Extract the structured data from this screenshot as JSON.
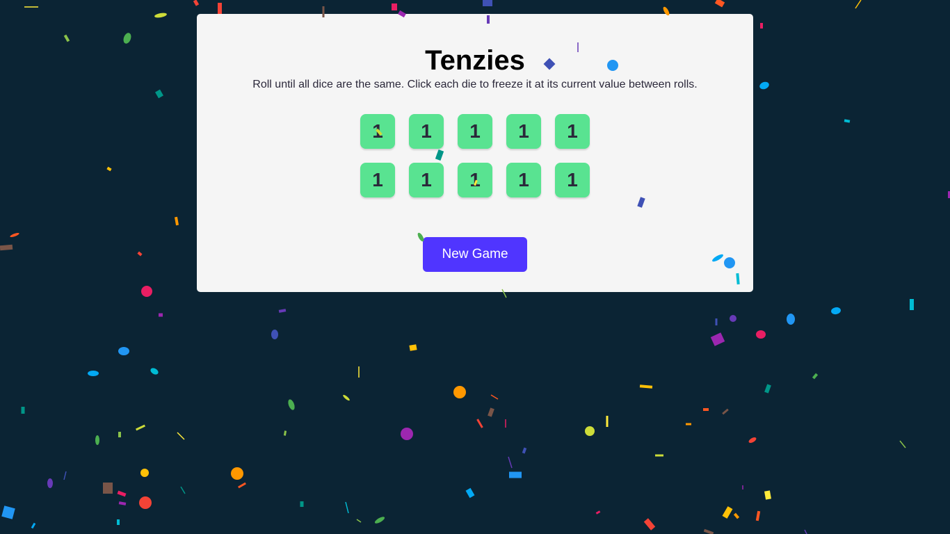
{
  "game": {
    "title": "Tenzies",
    "instructions": "Roll until all dice are the same. Click each die to freeze it at its current value between rolls.",
    "dice": [
      "1",
      "1",
      "1",
      "1",
      "1",
      "1",
      "1",
      "1",
      "1",
      "1"
    ],
    "button_label": "New Game"
  },
  "colors": {
    "background": "#0B2434",
    "card": "#F5F5F5",
    "die_held": "#59E391",
    "button": "#5035FF"
  }
}
